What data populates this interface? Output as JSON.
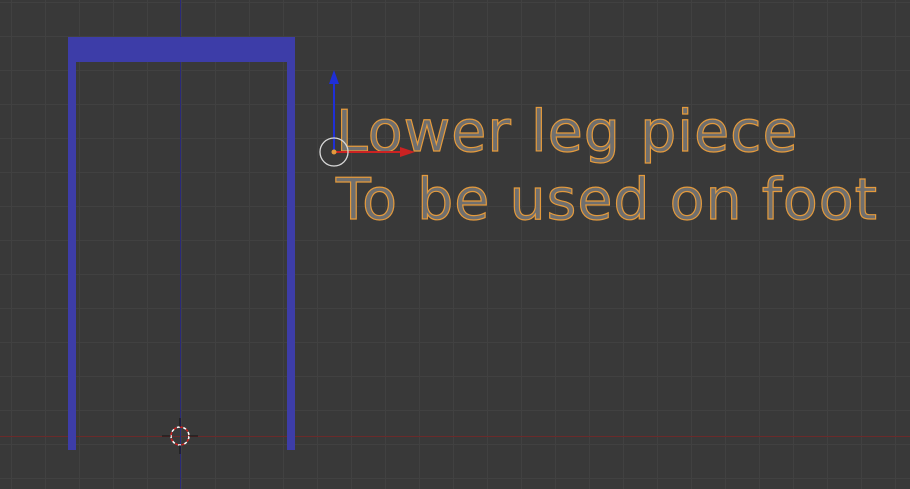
{
  "viewport": {
    "background_color": "#393939",
    "grid_color": "#414141",
    "x_axis_color": "#6b2a2a",
    "z_axis_color": "#2a2a7a"
  },
  "mesh": {
    "color": "#3d3da8"
  },
  "text_object": {
    "lines": [
      "Lower leg piece",
      "To be used on foot"
    ],
    "fill_color": "#6f6f6f",
    "outline_color": "#e49a3c"
  },
  "gizmo": {
    "x_arrow_color": "#cc2222",
    "z_arrow_color": "#1f2fd6",
    "origin_color": "#e49a3c"
  },
  "icons": {
    "cursor": "3d-cursor-icon",
    "manipulator": "transform-manipulator-icon",
    "origin": "object-origin-icon"
  }
}
